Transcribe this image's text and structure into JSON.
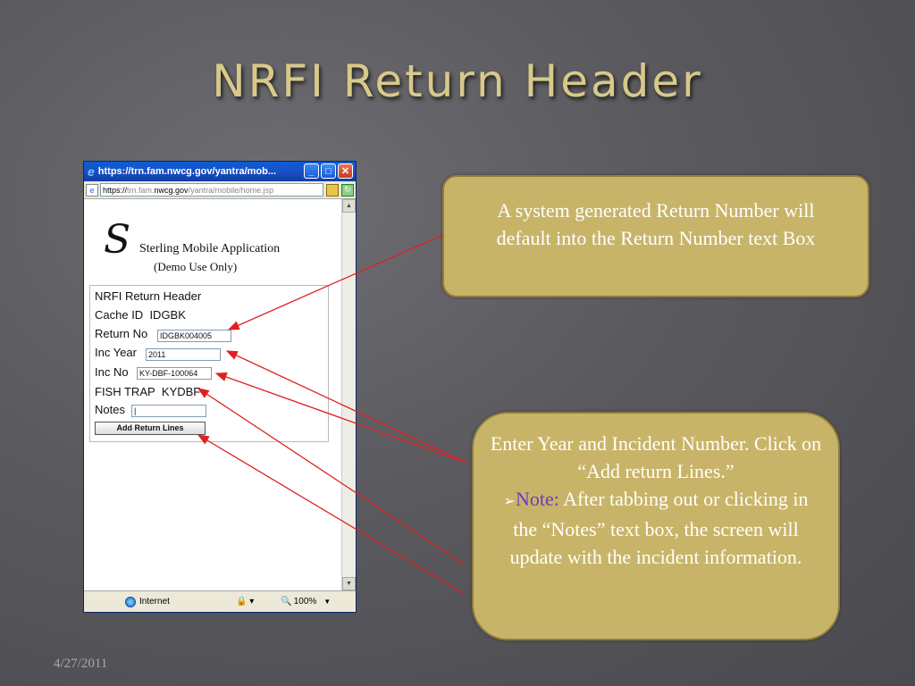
{
  "slide": {
    "title": "NRFI Return Header",
    "date": "4/27/2011"
  },
  "browser": {
    "title": "https://trn.fam.nwcg.gov/yantra/mob...",
    "address_prefix": "https://",
    "address_host_pre": "trn.fam.",
    "address_host_main": "nwcg.gov",
    "address_path": "/yantra/mobile/home.jsp",
    "status_zone": "Internet",
    "zoom": "100%"
  },
  "app": {
    "logo": "S",
    "name": "Sterling Mobile Application",
    "subtitle": "(Demo Use Only)"
  },
  "form": {
    "header": "NRFI Return Header",
    "cache_id_label": "Cache ID",
    "cache_id_value": "IDGBK",
    "return_no_label": "Return No",
    "return_no_value": "IDGBK004005",
    "inc_year_label": "Inc Year",
    "inc_year_value": "2011",
    "inc_no_label": "Inc No",
    "inc_no_value": "KY-DBF-100064",
    "incident_name_label": "FISH TRAP",
    "incident_name_value": "KYDBF",
    "notes_label": "Notes",
    "add_button": "Add Return Lines"
  },
  "callouts": {
    "first": "A system generated Return Number will default into the Return Number text Box",
    "second_main": "Enter Year and Incident Number. Click on “Add return Lines.”",
    "note_label": "Note:",
    "note_text": "After tabbing out  or clicking in the “Notes” text box, the screen will update with the incident  information."
  },
  "colors": {
    "title": "#d8c98a",
    "callout_fill": "#c8b468",
    "arrow": "#e02020",
    "note": "#6a3cbf"
  }
}
